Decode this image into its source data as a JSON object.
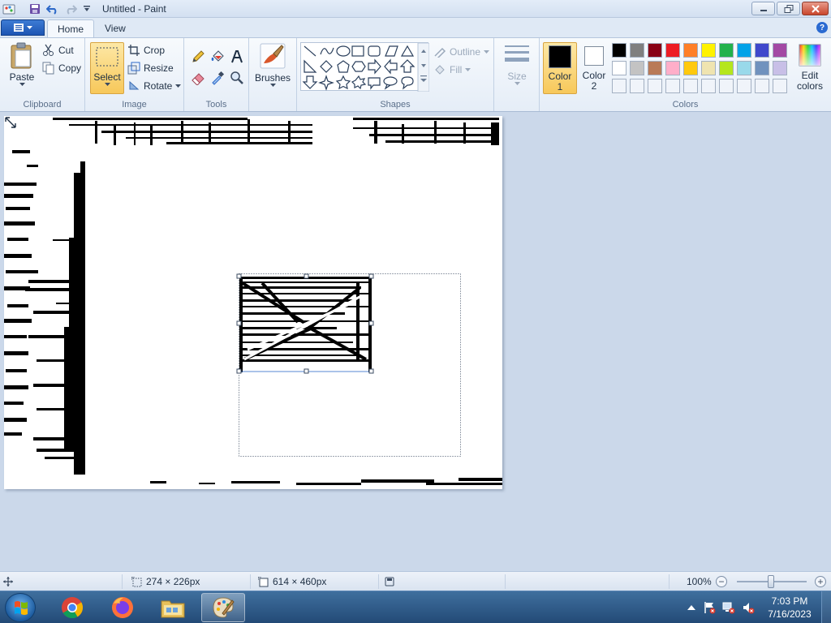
{
  "window": {
    "title": "Untitled - Paint"
  },
  "tabs": {
    "home": "Home",
    "view": "View"
  },
  "ribbon": {
    "clipboard": {
      "label": "Clipboard",
      "paste": "Paste",
      "cut": "Cut",
      "copy": "Copy"
    },
    "image": {
      "label": "Image",
      "select": "Select",
      "crop": "Crop",
      "resize": "Resize",
      "rotate": "Rotate"
    },
    "tools": {
      "label": "Tools"
    },
    "brushes": {
      "label": "Brushes"
    },
    "shapes": {
      "label": "Shapes",
      "outline": "Outline",
      "fill": "Fill"
    },
    "size": {
      "label": "Size"
    },
    "colors": {
      "label": "Colors",
      "color1": "Color 1",
      "color1_line1": "Color",
      "color1_line2": "1",
      "color2_line1": "Color",
      "color2_line2": "2",
      "color1_value": "#000000",
      "color2_value": "#ffffff",
      "edit_line1": "Edit",
      "edit_line2": "colors",
      "palette_row1": [
        "#000000",
        "#7f7f7f",
        "#880015",
        "#ed1c24",
        "#ff7f27",
        "#fff200",
        "#22b14c",
        "#00a2e8",
        "#3f48cc",
        "#a349a4"
      ],
      "palette_row2": [
        "#ffffff",
        "#c3c3c3",
        "#b97a57",
        "#ffaec9",
        "#ffc90e",
        "#efe4b0",
        "#b5e61d",
        "#99d9ea",
        "#7092be",
        "#c8bfe7"
      ],
      "palette_row3": [
        "#f0f4fa",
        "#f0f4fa",
        "#f0f4fa",
        "#f0f4fa",
        "#f0f4fa",
        "#f0f4fa",
        "#f0f4fa",
        "#f0f4fa",
        "#f0f4fa",
        "#f0f4fa"
      ]
    }
  },
  "statusbar": {
    "selection_size": "274 × 226px",
    "image_size": "614 × 460px",
    "zoom": "100%",
    "zoom_minus": "−",
    "zoom_plus": "+"
  },
  "taskbar": {
    "time": "7:03 PM",
    "date": "7/16/2023"
  }
}
